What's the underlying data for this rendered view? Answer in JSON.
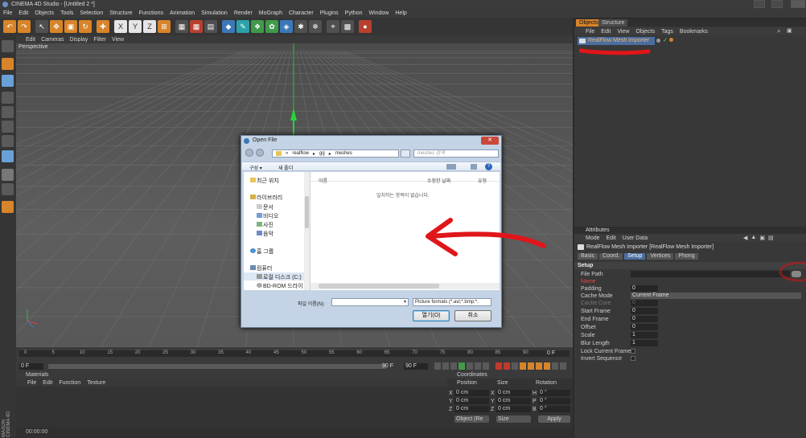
{
  "window": {
    "title": "CINEMA 4D Studio - [Untitled 2 *]"
  },
  "menu": [
    "File",
    "Edit",
    "Objects",
    "Tools",
    "Selection",
    "Structure",
    "Functions",
    "Animation",
    "Simulation",
    "Render",
    "MoGraph",
    "Character",
    "Plugins",
    "Python",
    "Window",
    "Help"
  ],
  "viewport": {
    "menu": [
      "Edit",
      "Cameras",
      "Display",
      "Filter",
      "View"
    ],
    "label": "Perspective"
  },
  "objects_panel": {
    "tabs": [
      "Objects",
      "Structure"
    ],
    "menu": [
      "File",
      "Edit",
      "View",
      "Objects",
      "Tags",
      "Bookmarks"
    ],
    "item": "RealFlow Mesh Importer"
  },
  "attributes_panel": {
    "tab": "Attributes",
    "menu": [
      "Mode",
      "Edit",
      "User Data"
    ],
    "object_title": "RealFlow Mesh Importer [RealFlow Mesh Importer]",
    "subtabs": [
      "Basic",
      "Coord.",
      "Setup",
      "Vertices",
      "Phong"
    ],
    "section": "Setup",
    "rows": [
      {
        "label": "File Path",
        "value": ""
      },
      {
        "label": "Name",
        "value": ""
      },
      {
        "label": "Padding",
        "value": "0"
      },
      {
        "label": "Cache Mode",
        "value": "Current Frame"
      },
      {
        "label": "Cache Core",
        "value": "0"
      },
      {
        "label": "Start Frame",
        "value": "0"
      },
      {
        "label": "End Frame",
        "value": "0"
      },
      {
        "label": "Offset",
        "value": "0"
      },
      {
        "label": "Scale",
        "value": "1"
      },
      {
        "label": "Blur Length",
        "value": "1"
      },
      {
        "label": "Lock Current Frame",
        "value": ""
      },
      {
        "label": "Invert Sequence",
        "value": ""
      }
    ]
  },
  "timeline": {
    "ticks": [
      "0",
      "5",
      "10",
      "15",
      "20",
      "25",
      "30",
      "35",
      "40",
      "45",
      "50",
      "55",
      "60",
      "65",
      "70",
      "75",
      "80",
      "85",
      "90"
    ],
    "start": "0 F",
    "end": "90 F",
    "current": "0 F",
    "field_a": "0 F",
    "field_b": "90 F"
  },
  "materials_panel": {
    "title": "Materials",
    "menu": [
      "File",
      "Edit",
      "Function",
      "Texture"
    ]
  },
  "coordinates_panel": {
    "title": "Coordinates",
    "headers": [
      "Position",
      "Size",
      "Rotation"
    ],
    "rows": [
      {
        "axis": "X",
        "pos": "0 cm",
        "size_axis": "X",
        "size": "0 cm",
        "rot_axis": "H",
        "rot": "0 °"
      },
      {
        "axis": "Y",
        "pos": "0 cm",
        "size_axis": "Y",
        "size": "0 cm",
        "rot_axis": "P",
        "rot": "0 °"
      },
      {
        "axis": "Z",
        "pos": "0 cm",
        "size_axis": "Z",
        "size": "0 cm",
        "rot_axis": "B",
        "rot": "0 °"
      }
    ],
    "mode_select": "Object (Re",
    "size_select": "Size",
    "apply": "Apply"
  },
  "status": {
    "time": "00:00:00",
    "brand": "MAXON CINEMA 4D"
  },
  "dialog": {
    "title": "Open File",
    "breadcrumb": [
      "realflow",
      "gg",
      "meshes"
    ],
    "breadcrumb_prefix": "«",
    "search_placeholder": "meshes 검색",
    "organize": "구성 ▾",
    "new_folder": "새 폴더",
    "nav": [
      "최근 위치",
      "라이브러리",
      "문서",
      "비디오",
      "사진",
      "음악",
      "홈 그룹",
      "컴퓨터",
      "로컬 디스크 (C:)",
      "BD-ROM 드라이"
    ],
    "col_name": "이름",
    "col_date": "수정한 날짜",
    "col_type": "유형",
    "empty_msg": "일치하는 항목이 없습니다.",
    "filename_label": "파일 이름(N):",
    "filter": "Picture formats (*.avi;*.bmp;*.",
    "open": "열기(O)",
    "cancel": "취소"
  },
  "colors": {
    "accent_orange": "#d7842a",
    "annotation_red": "#e0161a",
    "selection_blue": "#4a6ea0"
  }
}
